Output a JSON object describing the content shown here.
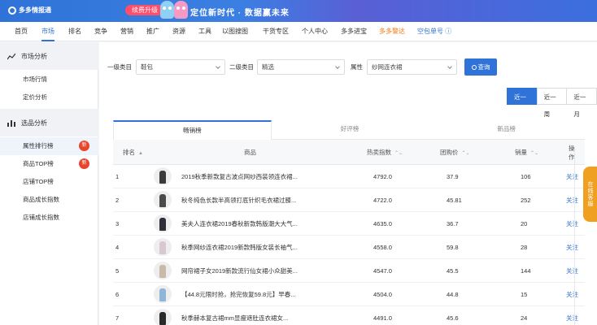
{
  "brand": {
    "name": "多多情报通"
  },
  "banner": {
    "promo_label": "续费升级",
    "headline": "定位新时代 · 数据赢未来"
  },
  "nav": [
    {
      "label": "首页",
      "style": "normal"
    },
    {
      "label": "市场",
      "style": "active"
    },
    {
      "label": "排名",
      "style": "normal"
    },
    {
      "label": "竞争",
      "style": "normal"
    },
    {
      "label": "营销",
      "style": "normal"
    },
    {
      "label": "推广",
      "style": "normal"
    },
    {
      "label": "资源",
      "style": "normal"
    },
    {
      "label": "工具",
      "style": "normal"
    },
    {
      "label": "以图搜图",
      "style": "normal"
    },
    {
      "label": "干货专区",
      "style": "normal"
    },
    {
      "label": "个人中心",
      "style": "normal"
    },
    {
      "label": "多多进宝",
      "style": "normal"
    },
    {
      "label": "多多警达",
      "style": "orange"
    },
    {
      "label": "空包单号 ⓘ",
      "style": "blue"
    }
  ],
  "sidebar": {
    "market_group": {
      "label": "市场分析",
      "icon": "trend-line-icon"
    },
    "market_items": [
      {
        "label": "市场行情"
      },
      {
        "label": "定价分析"
      }
    ],
    "product_group": {
      "label": "选品分析",
      "icon": "bar-chart-icon"
    },
    "product_items": [
      {
        "label": "属性排行榜",
        "badge": "新"
      },
      {
        "label": "商品TOP榜",
        "badge": "新"
      },
      {
        "label": "店铺TOP榜",
        "badge": ""
      },
      {
        "label": "商品成长指数",
        "badge": ""
      },
      {
        "label": "店铺成长指数",
        "badge": ""
      }
    ]
  },
  "filters": {
    "cat1_label": "一级类目",
    "cat1_value": "鞋包",
    "cat2_label": "二级类目",
    "cat2_value": "精选",
    "attr_label": "属性",
    "attr_value": "纱网连衣裙",
    "query_label": "查询"
  },
  "ranges": [
    {
      "label": "近一天",
      "active": true
    },
    {
      "label": "近一周",
      "active": false
    },
    {
      "label": "近一月",
      "active": false
    }
  ],
  "tabs": [
    {
      "label": "畅销榜",
      "active": true
    },
    {
      "label": "好评榜",
      "active": false
    },
    {
      "label": "新品榜",
      "active": false
    }
  ],
  "table": {
    "headers": {
      "rank": "排名",
      "product": "商品",
      "hot": "热卖指数",
      "price": "团购价",
      "sales": "销量",
      "action": "操作"
    },
    "rows": [
      {
        "rank": "1",
        "title": "2019秋季新款复古波点网纱西装领连衣裙...",
        "hot": "4792.0",
        "price": "37.9",
        "sales": "106",
        "action": "关注",
        "thumb_color": "#3b3b3b"
      },
      {
        "rank": "2",
        "title": "秋冬纯色长款半高领打底针织毛衣裙过膝...",
        "hot": "4722.0",
        "price": "45.81",
        "sales": "252",
        "action": "关注",
        "thumb_color": "#4a4a4a"
      },
      {
        "rank": "3",
        "title": "美夫人连衣裙2019春秋新款韩版潮大大气...",
        "hot": "4635.0",
        "price": "36.7",
        "sales": "20",
        "action": "关注",
        "thumb_color": "#2f2f3a"
      },
      {
        "rank": "4",
        "title": "秋季网纱连衣裙2019新款韩版女装长袖气...",
        "hot": "4558.0",
        "price": "59.8",
        "sales": "28",
        "action": "关注",
        "thumb_color": "#d7c8d2"
      },
      {
        "rank": "5",
        "title": "网帘裙子女2019新款流行仙女裙小众甜美...",
        "hot": "4547.0",
        "price": "45.5",
        "sales": "144",
        "action": "关注",
        "thumb_color": "#c9b9a8"
      },
      {
        "rank": "6",
        "title": "【44.8元限时抢，抢完恢复59.8元】早春...",
        "hot": "4504.0",
        "price": "44.8",
        "sales": "15",
        "action": "关注",
        "thumb_color": "#8fb6d6"
      },
      {
        "rank": "7",
        "title": "秋季赫本复古裙mm显瘦遮肚连衣裙女...",
        "hot": "4491.0",
        "price": "45.6",
        "sales": "24",
        "action": "关注",
        "thumb_color": "#2a2a2a"
      }
    ]
  },
  "float_button": {
    "label": "在线客服"
  },
  "colors": {
    "primary": "#2f73d8",
    "badge": "#e8452c",
    "orange": "#f07a16"
  }
}
